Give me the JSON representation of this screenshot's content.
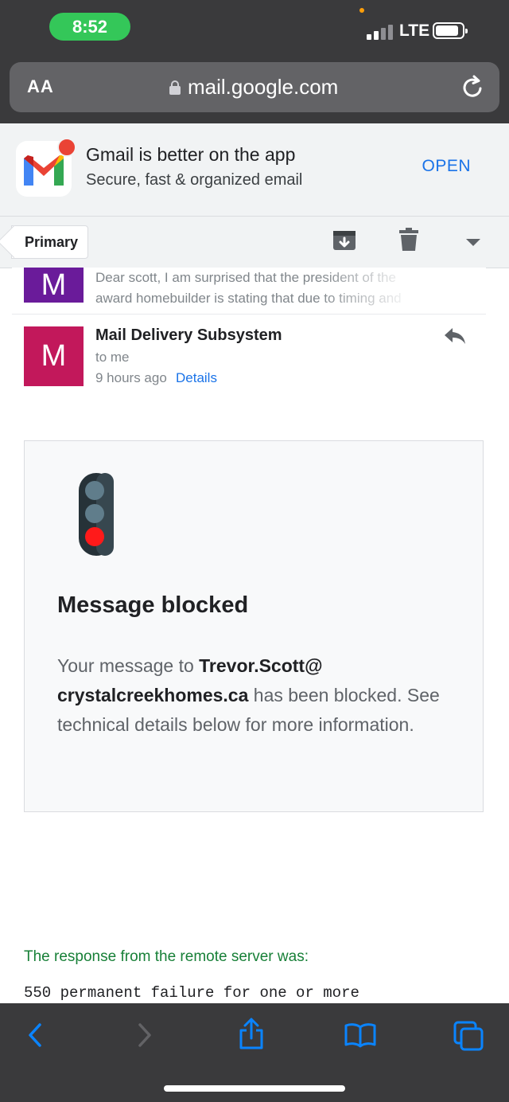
{
  "status_bar": {
    "time": "8:52",
    "network": "LTE"
  },
  "url_bar": {
    "aa_label": "AA",
    "url": "mail.google.com"
  },
  "app_banner": {
    "title": "Gmail is better on the app",
    "subtitle": "Secure, fast & organized email",
    "open_label": "OPEN"
  },
  "toolbar": {
    "back_label": "Primary"
  },
  "previous_message": {
    "avatar_letter": "M",
    "snippet": "Dear scott, I am surprised that the president of the award homebuilder is stating that due to timing and"
  },
  "message": {
    "avatar_letter": "M",
    "sender": "Mail Delivery Subsystem",
    "recipient": "to me",
    "time": "9 hours ago",
    "details_label": "Details"
  },
  "notice": {
    "title": "Message blocked",
    "body_prefix": "Your message to ",
    "recipient_address": "Trevor.Scott@ crystalcreekhomes.ca",
    "body_suffix": " has been blocked. See technical details below for more information."
  },
  "response_label": "The response from the remote server was:",
  "response_text": "550 permanent failure for one or more",
  "colors": {
    "accent": "#1a73e8",
    "status_pill": "#34c759",
    "sender_avatar": "#c2185b",
    "prev_avatar": "#6a1b9a",
    "response_green": "#188038",
    "ios_tint": "#0a84ff"
  }
}
